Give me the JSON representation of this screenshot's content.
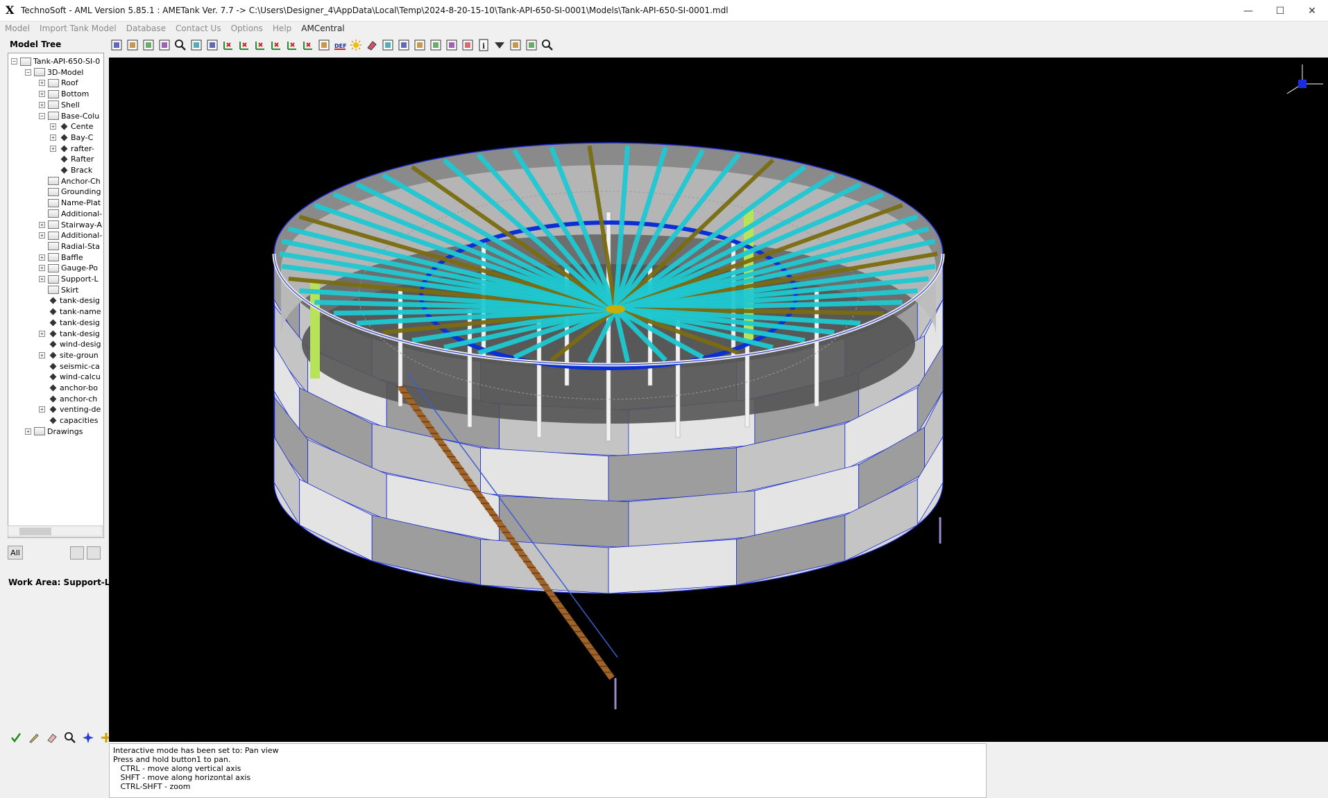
{
  "window": {
    "title": "TechnoSoft - AML Version 5.85.1 : AMETank Ver. 7.7 -> C:\\Users\\Designer_4\\AppData\\Local\\Temp\\2024-8-20-15-10\\Tank-API-650-SI-0001\\Models\\Tank-API-650-SI-0001.mdl",
    "minimize": "—",
    "maximize": "☐",
    "close": "✕"
  },
  "menu": [
    "Model",
    "Import Tank Model",
    "Database",
    "Contact Us",
    "Options",
    "Help",
    "AMCentral"
  ],
  "left": {
    "title": "Model Tree",
    "all_button": "All",
    "work_area": "Work Area: Support-Legs"
  },
  "tree": [
    {
      "label": "Tank-API-650-SI-0",
      "exp": "−",
      "icon": "folder-icon"
    },
    {
      "label": "3D-Model",
      "exp": "−",
      "icon": "model-icon"
    },
    {
      "label": "Roof",
      "exp": "+",
      "icon": "folder-icon"
    },
    {
      "label": "Bottom",
      "exp": "+",
      "icon": "folder-icon"
    },
    {
      "label": "Shell",
      "exp": "+",
      "icon": "folder-icon"
    },
    {
      "label": "Base-Colu",
      "exp": "−",
      "icon": "folder-icon"
    },
    {
      "label": "Cente",
      "exp": "+",
      "icon": "leaf-icon"
    },
    {
      "label": "Bay-C",
      "exp": "+",
      "icon": "leaf-icon"
    },
    {
      "label": "rafter-",
      "exp": "+",
      "icon": "leaf-icon"
    },
    {
      "label": "Rafter",
      "exp": "",
      "icon": "leaf-icon"
    },
    {
      "label": "Brack",
      "exp": "",
      "icon": "leaf-icon"
    },
    {
      "label": "Anchor-Ch",
      "exp": "",
      "icon": "folder-icon"
    },
    {
      "label": "Grounding",
      "exp": "",
      "icon": "folder-icon"
    },
    {
      "label": "Name-Plat",
      "exp": "",
      "icon": "folder-icon"
    },
    {
      "label": "Additional-",
      "exp": "",
      "icon": "folder-icon"
    },
    {
      "label": "Stairway-A",
      "exp": "+",
      "icon": "folder-icon"
    },
    {
      "label": "Additional-",
      "exp": "+",
      "icon": "folder-icon"
    },
    {
      "label": "Radial-Sta",
      "exp": "",
      "icon": "folder-icon"
    },
    {
      "label": "Baffle",
      "exp": "+",
      "icon": "folder-icon"
    },
    {
      "label": "Gauge-Po",
      "exp": "+",
      "icon": "folder-icon"
    },
    {
      "label": "Support-L",
      "exp": "+",
      "icon": "folder-icon"
    },
    {
      "label": "Skirt",
      "exp": "",
      "icon": "folder-icon"
    },
    {
      "label": "tank-desig",
      "exp": "",
      "icon": "leaf-icon"
    },
    {
      "label": "tank-name",
      "exp": "",
      "icon": "leaf-icon"
    },
    {
      "label": "tank-desig",
      "exp": "",
      "icon": "leaf-icon"
    },
    {
      "label": "tank-desig",
      "exp": "+",
      "icon": "leaf-icon"
    },
    {
      "label": "wind-desig",
      "exp": "",
      "icon": "leaf-icon"
    },
    {
      "label": "site-groun",
      "exp": "+",
      "icon": "leaf-icon"
    },
    {
      "label": "seismic-ca",
      "exp": "",
      "icon": "leaf-icon"
    },
    {
      "label": "wind-calcu",
      "exp": "",
      "icon": "leaf-icon"
    },
    {
      "label": "anchor-bo",
      "exp": "",
      "icon": "leaf-icon"
    },
    {
      "label": "anchor-ch",
      "exp": "",
      "icon": "leaf-icon"
    },
    {
      "label": "venting-de",
      "exp": "+",
      "icon": "leaf-icon"
    },
    {
      "label": "capacities",
      "exp": "",
      "icon": "leaf-icon"
    },
    {
      "label": "Drawings",
      "exp": "+",
      "icon": "folder-icon"
    }
  ],
  "toolbar": [
    "pan-icon",
    "rotate-icon",
    "rotate-alt-icon",
    "center-icon",
    "zoom-icon",
    "zoom-window-icon",
    "fit-icon",
    "view-x-icon",
    "view-y-icon",
    "view-z-icon",
    "view-xy-icon",
    "view-yz-icon",
    "view-zx-icon",
    "axes-icon",
    "def-icon",
    "light-icon",
    "erase-icon",
    "pick-icon",
    "copy-icon",
    "solid-icon",
    "wire-icon",
    "shade-icon",
    "refresh-icon",
    "info-icon",
    "filter-icon",
    "group-icon",
    "edit-icon",
    "inspect-icon"
  ],
  "bottom_tools": [
    "check-icon",
    "pencil-icon",
    "eraser-icon",
    "zoom-icon",
    "snap-icon",
    "add-icon"
  ],
  "console": [
    "Interactive mode has been set to: Pan view",
    "Press and hold button1 to pan.",
    "   CTRL - move along vertical axis",
    "   SHFT - move along horizontal axis",
    "   CTRL-SHFT - zoom"
  ],
  "colors": {
    "viewport_bg": "#000000",
    "rafter_cyan": "#1fc9d2",
    "rafter_olive": "#7a6d10",
    "girder_blue": "#0a2fd4",
    "shell_light": "#d8d8d8",
    "shell_dark": "#9d9d9d",
    "edge_line": "#1a2bd0"
  }
}
